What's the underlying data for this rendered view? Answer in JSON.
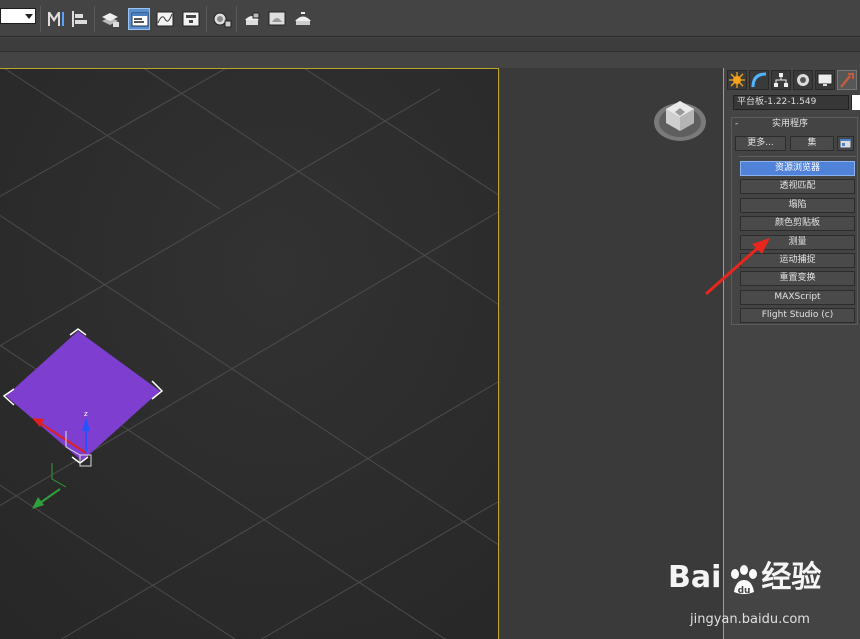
{
  "toolbar": {
    "dropdown_value": "",
    "icons": [
      "mirror-icon",
      "align-icon",
      "layer-manager-icon",
      "scene-explorer-icon",
      "curve-editor-icon",
      "schematic-view-icon",
      "material-editor-icon",
      "render-setup-icon",
      "rendered-frame-icon",
      "render-production-icon",
      "render-iterative-icon"
    ]
  },
  "command_panel": {
    "tabs": [
      "create-tab",
      "modify-tab",
      "hierarchy-tab",
      "motion-tab",
      "display-tab",
      "utilities-tab"
    ],
    "object_name": "平台板-1.22-1.549",
    "object_color": "#ffffff",
    "rollout": {
      "title": "实用程序",
      "collapse_symbol": "-",
      "more_label": "更多...",
      "sets_label": "集",
      "utilities": [
        {
          "label": "资源浏览器",
          "highlighted": true
        },
        {
          "label": "透视匹配",
          "highlighted": false
        },
        {
          "label": "塌陷",
          "highlighted": false
        },
        {
          "label": "颜色剪贴板",
          "highlighted": false
        },
        {
          "label": "测量",
          "highlighted": false
        },
        {
          "label": "运动捕捉",
          "highlighted": false
        },
        {
          "label": "重置变换",
          "highlighted": false
        },
        {
          "label": "MAXScript",
          "highlighted": false
        },
        {
          "label": "Flight Studio (c)",
          "highlighted": false
        }
      ]
    }
  },
  "viewport": {
    "object_color": "#7e3fd0",
    "border_color": "#b9a52d",
    "gizmo_axis_label": "z"
  },
  "annotation": {
    "arrow_color": "#e8261d"
  },
  "watermark": {
    "logo_left": "Bai",
    "logo_right": "经验",
    "url": "jingyan.baidu.com"
  }
}
